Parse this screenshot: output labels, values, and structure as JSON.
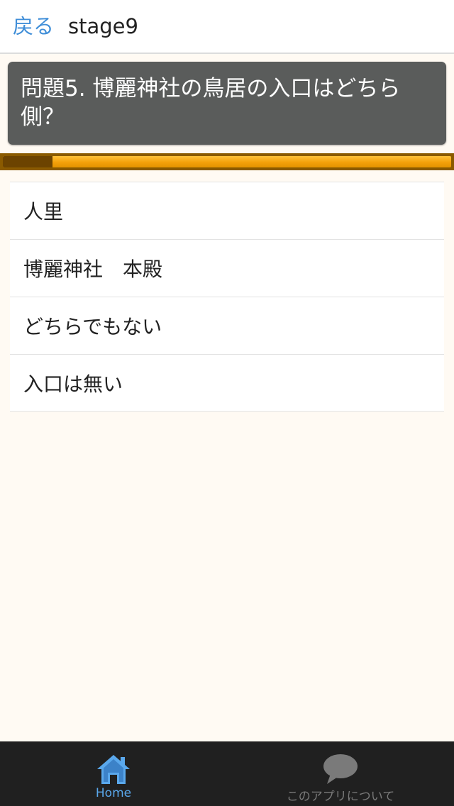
{
  "header": {
    "back_label": "戻る",
    "title": "stage9"
  },
  "question": {
    "text": "問題5. 博麗神社の鳥居の入口はどちら側？"
  },
  "progress": {
    "fraction": 0.11
  },
  "answers": [
    {
      "label": "人里"
    },
    {
      "label": "博麗神社　本殿"
    },
    {
      "label": "どちらでもない"
    },
    {
      "label": "入口は無い"
    }
  ],
  "tabs": [
    {
      "label": "Home",
      "icon": "home-icon",
      "active": true
    },
    {
      "label": "このアプリについて",
      "icon": "speech-bubble-icon",
      "active": false
    }
  ],
  "colors": {
    "accent_blue": "#3f8ed8",
    "active_tab_blue": "#5aa8ec",
    "question_bg": "#5a5c5b",
    "progress_orange": "#f3a00a",
    "progress_dark": "#6c4300",
    "tab_bar_bg": "#202020"
  }
}
